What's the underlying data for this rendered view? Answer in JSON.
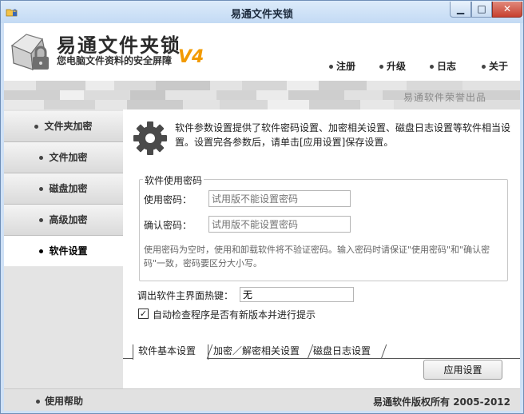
{
  "window": {
    "title": "易通文件夹锁",
    "minimize": "▁",
    "maximize": "□",
    "close": "✕"
  },
  "brand": {
    "name": "易通文件夹锁",
    "slogan": "您电脑文件资料的安全屏障",
    "version": "V4",
    "company_note": "易通软件荣誉出品"
  },
  "nav": {
    "register": "注册",
    "upgrade": "升级",
    "log": "日志",
    "about": "关于"
  },
  "sidebar": {
    "items": [
      {
        "label": "文件夹加密"
      },
      {
        "label": "文件加密"
      },
      {
        "label": "磁盘加密"
      },
      {
        "label": "高级加密"
      },
      {
        "label": "软件设置"
      }
    ],
    "active_index": 4
  },
  "main": {
    "intro": "软件参数设置提供了软件密码设置、加密相关设置、磁盘日志设置等软件相当设置。设置完各参数后，请单击[应用设置]保存设置。",
    "password_group": {
      "legend": "软件使用密码",
      "password_label": "使用密码：",
      "password_placeholder": "试用版不能设置密码",
      "confirm_label": "确认密码：",
      "confirm_placeholder": "试用版不能设置密码",
      "help": "使用密码为空时，使用和卸载软件将不验证密码。输入密码时请保证\"使用密码\"和\"确认密码\"一致，密码要区分大小写。"
    },
    "hotkey_label": "调出软件主界面热键：",
    "hotkey_value": "无",
    "auto_check_label": "自动检查程序是否有新版本并进行提示",
    "auto_check_checked": true,
    "tabs": [
      {
        "label": "软件基本设置"
      },
      {
        "label": "加密／解密相关设置"
      },
      {
        "label": "磁盘日志设置"
      }
    ],
    "apply_label": "应用设置"
  },
  "status": {
    "help_label": "使用帮助",
    "copyright": "易通软件版权所有 2005-2012"
  },
  "colors": {
    "titlebar": "#c3daf4",
    "accent_version": "#f29a00",
    "close_button": "#c7402f"
  },
  "icons": {
    "app": "folder-lock-icon",
    "logo": "folder-lock-logo",
    "settings": "gear-icon",
    "bullet": "bullet-icon"
  }
}
